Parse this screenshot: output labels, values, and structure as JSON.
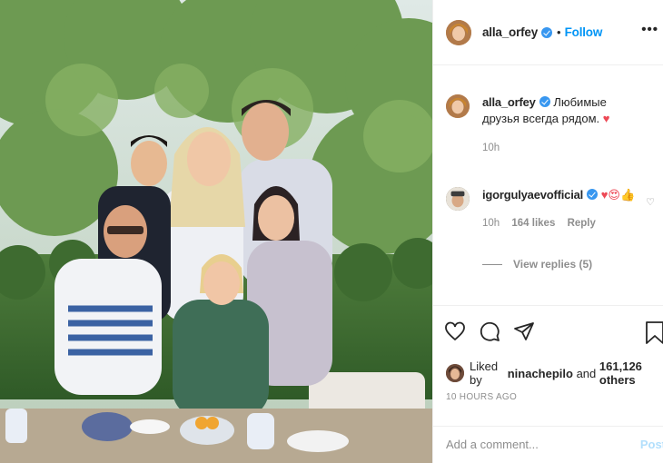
{
  "post": {
    "username": "alla_orfey",
    "follow_label": "Follow",
    "separator": "•",
    "more_label": "•••"
  },
  "caption": {
    "username": "alla_orfey",
    "text": "Любимые друзья всегда рядом.",
    "emoji": "♥",
    "time": "10h"
  },
  "comment": {
    "username": "igorgulyaevofficial",
    "emoji": "♥😍👍",
    "time": "10h",
    "likes": "164 likes",
    "reply_label": "Reply",
    "view_replies": "View replies (5)"
  },
  "likes": {
    "prefix": "Liked by",
    "user": "ninachepilo",
    "middle": "and",
    "count": "161,126 others"
  },
  "timestamp": "10 HOURS AGO",
  "add_comment": {
    "placeholder": "Add a comment...",
    "post_label": "Post"
  },
  "colors": {
    "accent": "#0095f6",
    "muted": "#8e8e8e",
    "heart": "#ed4956",
    "post_disabled": "#b2dffc"
  },
  "icons": [
    "verified-icon",
    "more-icon",
    "heart-icon",
    "comment-icon",
    "share-icon",
    "save-icon"
  ]
}
